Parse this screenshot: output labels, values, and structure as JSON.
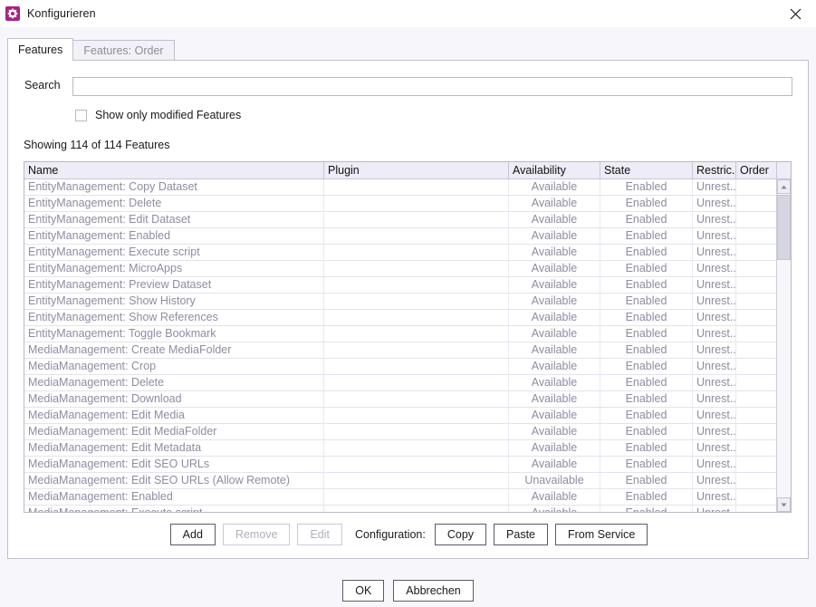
{
  "window": {
    "title": "Konfigurieren",
    "icon": "gear-icon",
    "icon_color": "#a4248a",
    "close_icon": "close-icon"
  },
  "tabs": [
    {
      "label": "Features",
      "active": true
    },
    {
      "label": "Features: Order",
      "active": false
    }
  ],
  "search": {
    "label": "Search",
    "value": "",
    "placeholder": ""
  },
  "filter": {
    "modified_checkbox_label": "Show only modified Features",
    "modified_checked": false
  },
  "status": {
    "showing": "Showing 114 of 114 Features"
  },
  "table": {
    "columns": [
      {
        "key": "name",
        "label": "Name",
        "align": "left"
      },
      {
        "key": "plugin",
        "label": "Plugin",
        "align": "left"
      },
      {
        "key": "availability",
        "label": "Availability",
        "align": "center"
      },
      {
        "key": "state",
        "label": "State",
        "align": "center"
      },
      {
        "key": "restriction",
        "label": "Restric...",
        "align": "left"
      },
      {
        "key": "order",
        "label": "Order",
        "align": "left"
      }
    ],
    "rows": [
      {
        "name": "EntityManagement: Copy Dataset",
        "plugin": "",
        "availability": "Available",
        "state": "Enabled",
        "restriction": "Unrest...",
        "order": ""
      },
      {
        "name": "EntityManagement: Delete",
        "plugin": "",
        "availability": "Available",
        "state": "Enabled",
        "restriction": "Unrest...",
        "order": ""
      },
      {
        "name": "EntityManagement: Edit Dataset",
        "plugin": "",
        "availability": "Available",
        "state": "Enabled",
        "restriction": "Unrest...",
        "order": ""
      },
      {
        "name": "EntityManagement: Enabled",
        "plugin": "",
        "availability": "Available",
        "state": "Enabled",
        "restriction": "Unrest...",
        "order": ""
      },
      {
        "name": "EntityManagement: Execute script",
        "plugin": "",
        "availability": "Available",
        "state": "Enabled",
        "restriction": "Unrest...",
        "order": ""
      },
      {
        "name": "EntityManagement: MicroApps",
        "plugin": "",
        "availability": "Available",
        "state": "Enabled",
        "restriction": "Unrest...",
        "order": ""
      },
      {
        "name": "EntityManagement: Preview Dataset",
        "plugin": "",
        "availability": "Available",
        "state": "Enabled",
        "restriction": "Unrest...",
        "order": ""
      },
      {
        "name": "EntityManagement: Show History",
        "plugin": "",
        "availability": "Available",
        "state": "Enabled",
        "restriction": "Unrest...",
        "order": ""
      },
      {
        "name": "EntityManagement: Show References",
        "plugin": "",
        "availability": "Available",
        "state": "Enabled",
        "restriction": "Unrest...",
        "order": ""
      },
      {
        "name": "EntityManagement: Toggle Bookmark",
        "plugin": "",
        "availability": "Available",
        "state": "Enabled",
        "restriction": "Unrest...",
        "order": ""
      },
      {
        "name": "MediaManagement: Create MediaFolder",
        "plugin": "",
        "availability": "Available",
        "state": "Enabled",
        "restriction": "Unrest...",
        "order": ""
      },
      {
        "name": "MediaManagement: Crop",
        "plugin": "",
        "availability": "Available",
        "state": "Enabled",
        "restriction": "Unrest...",
        "order": ""
      },
      {
        "name": "MediaManagement: Delete",
        "plugin": "",
        "availability": "Available",
        "state": "Enabled",
        "restriction": "Unrest...",
        "order": ""
      },
      {
        "name": "MediaManagement: Download",
        "plugin": "",
        "availability": "Available",
        "state": "Enabled",
        "restriction": "Unrest...",
        "order": ""
      },
      {
        "name": "MediaManagement: Edit Media",
        "plugin": "",
        "availability": "Available",
        "state": "Enabled",
        "restriction": "Unrest...",
        "order": ""
      },
      {
        "name": "MediaManagement: Edit MediaFolder",
        "plugin": "",
        "availability": "Available",
        "state": "Enabled",
        "restriction": "Unrest...",
        "order": ""
      },
      {
        "name": "MediaManagement: Edit Metadata",
        "plugin": "",
        "availability": "Available",
        "state": "Enabled",
        "restriction": "Unrest...",
        "order": ""
      },
      {
        "name": "MediaManagement: Edit SEO URLs",
        "plugin": "",
        "availability": "Available",
        "state": "Enabled",
        "restriction": "Unrest...",
        "order": ""
      },
      {
        "name": "MediaManagement: Edit SEO URLs (Allow Remote)",
        "plugin": "",
        "availability": "Unavailable",
        "state": "Enabled",
        "restriction": "Unrest...",
        "order": ""
      },
      {
        "name": "MediaManagement: Enabled",
        "plugin": "",
        "availability": "Available",
        "state": "Enabled",
        "restriction": "Unrest...",
        "order": ""
      },
      {
        "name": "MediaManagement: Execute script",
        "plugin": "",
        "availability": "Available",
        "state": "Enabled",
        "restriction": "Unrest...",
        "order": ""
      }
    ]
  },
  "actions": {
    "add": "Add",
    "remove": "Remove",
    "edit": "Edit",
    "configuration_label": "Configuration:",
    "copy": "Copy",
    "paste": "Paste",
    "from_service": "From Service"
  },
  "footer": {
    "ok": "OK",
    "cancel": "Abbrechen"
  }
}
